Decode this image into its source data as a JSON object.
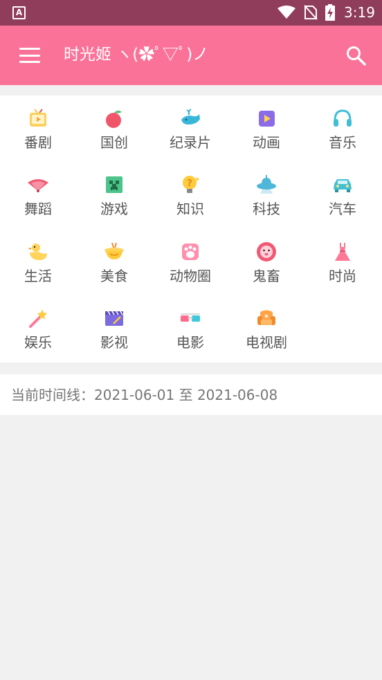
{
  "status_bar": {
    "left_badge": "A",
    "time": "3:19"
  },
  "app_bar": {
    "title": "时光姬 ヽ(✿ﾟ▽ﾟ)ノ"
  },
  "categories": [
    {
      "label": "番剧",
      "icon": "tv-icon"
    },
    {
      "label": "国创",
      "icon": "peach-icon"
    },
    {
      "label": "纪录片",
      "icon": "whale-icon"
    },
    {
      "label": "动画",
      "icon": "play-tile-icon"
    },
    {
      "label": "音乐",
      "icon": "headphones-icon"
    },
    {
      "label": "舞蹈",
      "icon": "fan-icon"
    },
    {
      "label": "游戏",
      "icon": "creeper-icon"
    },
    {
      "label": "知识",
      "icon": "lightbulb-icon"
    },
    {
      "label": "科技",
      "icon": "ufo-icon"
    },
    {
      "label": "汽车",
      "icon": "car-icon"
    },
    {
      "label": "生活",
      "icon": "duck-icon"
    },
    {
      "label": "美食",
      "icon": "food-bowl-icon"
    },
    {
      "label": "动物圈",
      "icon": "paw-icon"
    },
    {
      "label": "鬼畜",
      "icon": "lion-icon"
    },
    {
      "label": "时尚",
      "icon": "dress-icon"
    },
    {
      "label": "娱乐",
      "icon": "magic-wand-icon"
    },
    {
      "label": "影视",
      "icon": "clapperboard-icon"
    },
    {
      "label": "电影",
      "icon": "3d-glasses-icon"
    },
    {
      "label": "电视剧",
      "icon": "sofa-icon"
    }
  ],
  "timeline": {
    "text": "当前时间线：2021-06-01 至 2021-06-08"
  }
}
